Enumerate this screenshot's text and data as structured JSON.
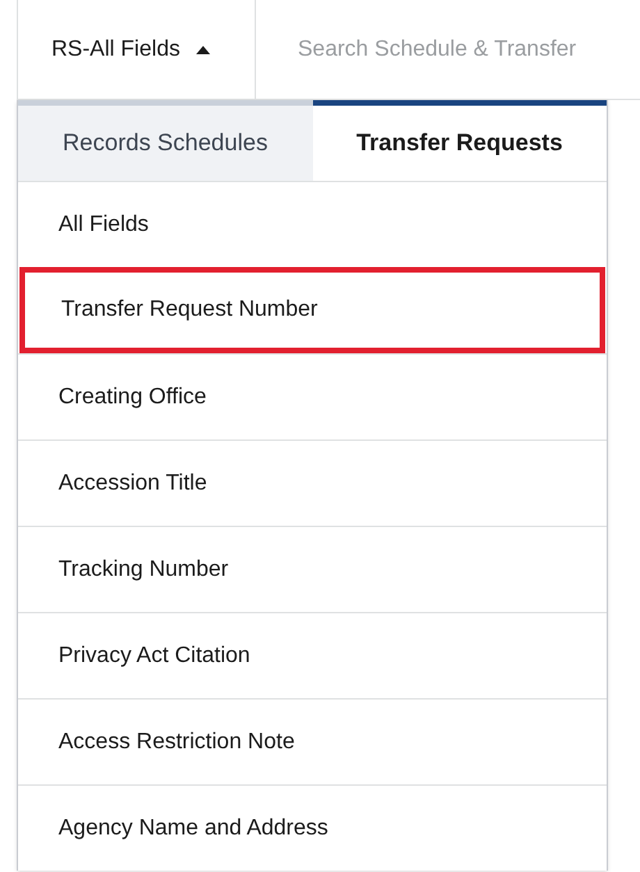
{
  "search_bar": {
    "field_selector": {
      "label": "RS-All Fields",
      "expanded": true
    },
    "search": {
      "placeholder": "Search Schedule & Transfer"
    }
  },
  "tabs": [
    {
      "label": "Records Schedules",
      "selected": false
    },
    {
      "label": "Transfer Requests",
      "selected": true
    }
  ],
  "menu_items": [
    {
      "label": "All Fields",
      "highlighted": false
    },
    {
      "label": "Transfer Request Number",
      "highlighted": true
    },
    {
      "label": "Creating Office",
      "highlighted": false
    },
    {
      "label": "Accession Title",
      "highlighted": false
    },
    {
      "label": "Tracking Number",
      "highlighted": false
    },
    {
      "label": "Privacy Act Citation",
      "highlighted": false
    },
    {
      "label": "Access Restriction Note",
      "highlighted": false
    },
    {
      "label": "Agency Name and Address",
      "highlighted": false
    }
  ]
}
